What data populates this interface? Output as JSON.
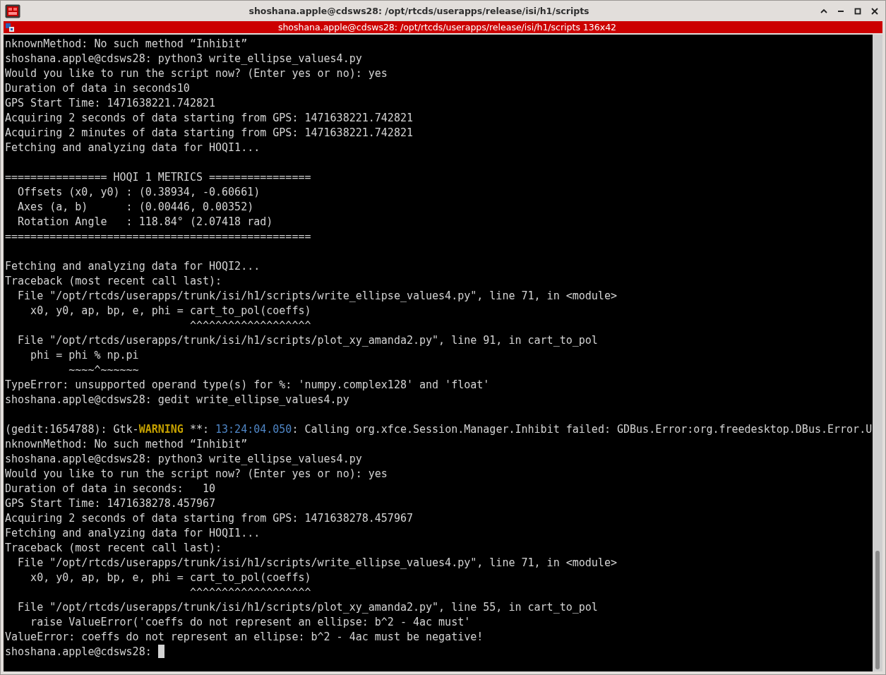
{
  "window": {
    "title": "shoshana.apple@cdsws28: /opt/rtcds/userapps/release/isi/h1/scripts"
  },
  "terminal_tab": {
    "title": "shoshana.apple@cdsws28: /opt/rtcds/userapps/release/isi/h1/scripts 136x42"
  },
  "lines": [
    {
      "kind": "text",
      "text": "nknownMethod: No such method “Inhibit”"
    },
    {
      "kind": "text",
      "text": "shoshana.apple@cdsws28: python3 write_ellipse_values4.py"
    },
    {
      "kind": "text",
      "text": "Would you like to run the script now? (Enter yes or no): yes"
    },
    {
      "kind": "text",
      "text": "Duration of data in seconds10"
    },
    {
      "kind": "text",
      "text": "GPS Start Time: 1471638221.742821"
    },
    {
      "kind": "text",
      "text": "Acquiring 2 seconds of data starting from GPS: 1471638221.742821"
    },
    {
      "kind": "text",
      "text": "Acquiring 2 minutes of data starting from GPS: 1471638221.742821"
    },
    {
      "kind": "text",
      "text": "Fetching and analyzing data for HOQI1..."
    },
    {
      "kind": "blank"
    },
    {
      "kind": "text",
      "text": "================ HOQI 1 METRICS ================"
    },
    {
      "kind": "text",
      "text": "  Offsets (x0, y0) : (0.38934, -0.60661)"
    },
    {
      "kind": "text",
      "text": "  Axes (a, b)      : (0.00446, 0.00352)"
    },
    {
      "kind": "text",
      "text": "  Rotation Angle   : 118.84° (2.07418 rad)"
    },
    {
      "kind": "text",
      "text": "================================================"
    },
    {
      "kind": "blank"
    },
    {
      "kind": "text",
      "text": "Fetching and analyzing data for HOQI2..."
    },
    {
      "kind": "text",
      "text": "Traceback (most recent call last):"
    },
    {
      "kind": "text",
      "text": "  File \"/opt/rtcds/userapps/trunk/isi/h1/scripts/write_ellipse_values4.py\", line 71, in <module>"
    },
    {
      "kind": "text",
      "text": "    x0, y0, ap, bp, e, phi = cart_to_pol(coeffs)"
    },
    {
      "kind": "text",
      "text": "                             ^^^^^^^^^^^^^^^^^^^"
    },
    {
      "kind": "text",
      "text": "  File \"/opt/rtcds/userapps/trunk/isi/h1/scripts/plot_xy_amanda2.py\", line 91, in cart_to_pol"
    },
    {
      "kind": "text",
      "text": "    phi = phi % np.pi"
    },
    {
      "kind": "text",
      "text": "          ~~~~^~~~~~~"
    },
    {
      "kind": "text",
      "text": "TypeError: unsupported operand type(s) for %: 'numpy.complex128' and 'float'"
    },
    {
      "kind": "text",
      "text": "shoshana.apple@cdsws28: gedit write_ellipse_values4.py"
    },
    {
      "kind": "blank"
    },
    {
      "kind": "segments",
      "parts": [
        {
          "kind": "plain",
          "text": "(gedit:1654788): Gtk-"
        },
        {
          "kind": "warning",
          "text": "WARNING"
        },
        {
          "kind": "plain",
          "text": " **: "
        },
        {
          "kind": "time",
          "text": "13:24:04.050"
        },
        {
          "kind": "plain",
          "text": ": Calling org.xfce.Session.Manager.Inhibit failed: GDBus.Error:org.freedesktop.DBus.Error.U"
        }
      ]
    },
    {
      "kind": "text",
      "text": "nknownMethod: No such method “Inhibit”"
    },
    {
      "kind": "text",
      "text": "shoshana.apple@cdsws28: python3 write_ellipse_values4.py"
    },
    {
      "kind": "text",
      "text": "Would you like to run the script now? (Enter yes or no): yes"
    },
    {
      "kind": "text",
      "text": "Duration of data in seconds:   10"
    },
    {
      "kind": "text",
      "text": "GPS Start Time: 1471638278.457967"
    },
    {
      "kind": "text",
      "text": "Acquiring 2 seconds of data starting from GPS: 1471638278.457967"
    },
    {
      "kind": "text",
      "text": "Fetching and analyzing data for HOQI1..."
    },
    {
      "kind": "text",
      "text": "Traceback (most recent call last):"
    },
    {
      "kind": "text",
      "text": "  File \"/opt/rtcds/userapps/trunk/isi/h1/scripts/write_ellipse_values4.py\", line 71, in <module>"
    },
    {
      "kind": "text",
      "text": "    x0, y0, ap, bp, e, phi = cart_to_pol(coeffs)"
    },
    {
      "kind": "text",
      "text": "                             ^^^^^^^^^^^^^^^^^^^"
    },
    {
      "kind": "text",
      "text": "  File \"/opt/rtcds/userapps/trunk/isi/h1/scripts/plot_xy_amanda2.py\", line 55, in cart_to_pol"
    },
    {
      "kind": "text",
      "text": "    raise ValueError('coeffs do not represent an ellipse: b^2 - 4ac must'"
    },
    {
      "kind": "text",
      "text": "ValueError: coeffs do not represent an ellipse: b^2 - 4ac must be negative!"
    },
    {
      "kind": "prompt",
      "text": "shoshana.apple@cdsws28: ",
      "cursor": true
    }
  ]
}
